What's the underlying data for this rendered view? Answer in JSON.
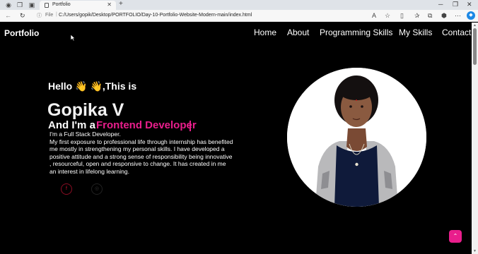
{
  "browser": {
    "tab_title": "Portfolio",
    "address_label": "File",
    "url": "C:/Users/gopik/Desktop/PORTFOLIO/Day-10-Portfolio-Website-Modern-main/index.html"
  },
  "nav": {
    "logo": "Portfolio",
    "items": [
      {
        "label": "Home"
      },
      {
        "label": "About"
      },
      {
        "label": "Programming Skills"
      },
      {
        "label": "My Skills"
      },
      {
        "label": "Contact"
      }
    ]
  },
  "hero": {
    "greeting": "Hello 👋 👋,This is",
    "name": "Gopika V",
    "role_prefix": "And I'm a",
    "role": "Frontend Developer",
    "subtitle": "I'm a Full Stack Developer.",
    "bio": "My first exposure to professional life through internship has benefited me mostly in strengthening my personal skills. I have developed a positive attitude and a strong sense of responsibility being innovative , resourceful, open and responsive to change. It has created in me an interest in lifelong learning."
  },
  "social": [
    {
      "icon": "facebook-icon",
      "glyph": "f"
    },
    {
      "icon": "instagram-icon",
      "glyph": "◎"
    }
  ],
  "colors": {
    "accent": "#e91e8c",
    "background": "#000000",
    "social_ring": "#8b0d24"
  }
}
